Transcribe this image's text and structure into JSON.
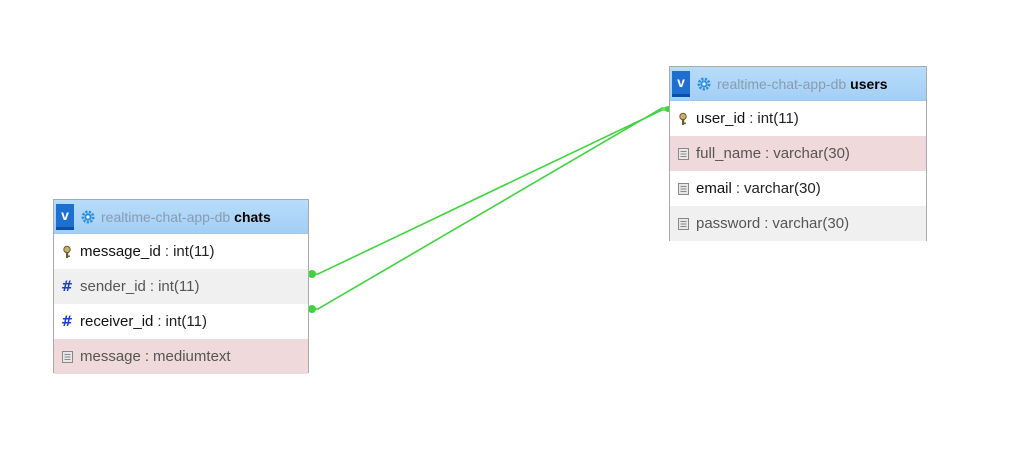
{
  "tables": [
    {
      "id": "chats",
      "database": "realtime-chat-app-db",
      "name": "chats",
      "toggle_label": "v",
      "columns": [
        {
          "name": "message_id",
          "sep": ":",
          "type": "int(11)",
          "icon": "primary-key-icon",
          "row_color": "#ffffff"
        },
        {
          "name": "sender_id",
          "sep": ":",
          "type": "int(11)",
          "icon": "numeric-hash-icon",
          "row_color": "#f0f0f0"
        },
        {
          "name": "receiver_id",
          "sep": ":",
          "type": "int(11)",
          "icon": "numeric-hash-icon",
          "row_color": "#ffffff"
        },
        {
          "name": "message",
          "sep": ":",
          "type": "mediumtext",
          "icon": "text-field-icon",
          "row_color": "#efd9da"
        }
      ]
    },
    {
      "id": "users",
      "database": "realtime-chat-app-db",
      "name": "users",
      "toggle_label": "v",
      "columns": [
        {
          "name": "user_id",
          "sep": ":",
          "type": "int(11)",
          "icon": "primary-key-icon",
          "row_color": "#ffffff"
        },
        {
          "name": "full_name",
          "sep": ":",
          "type": "varchar(30)",
          "icon": "text-field-icon",
          "row_color": "#efd9da"
        },
        {
          "name": "email",
          "sep": ":",
          "type": "varchar(30)",
          "icon": "text-field-icon",
          "row_color": "#ffffff"
        },
        {
          "name": "password",
          "sep": ":",
          "type": "varchar(30)",
          "icon": "text-field-icon",
          "row_color": "#f0f0f0"
        }
      ]
    }
  ],
  "relations": [
    {
      "from_table": "chats",
      "from_column": "sender_id",
      "to_table": "users",
      "to_column": "user_id"
    },
    {
      "from_table": "chats",
      "from_column": "receiver_id",
      "to_table": "users",
      "to_column": "user_id"
    }
  ],
  "colors": {
    "relation_line": "#3fd43f",
    "header_bg": "#a9d4f7",
    "toggle_bg": "#1f6fd0",
    "hash_icon": "#1a3fd4"
  }
}
